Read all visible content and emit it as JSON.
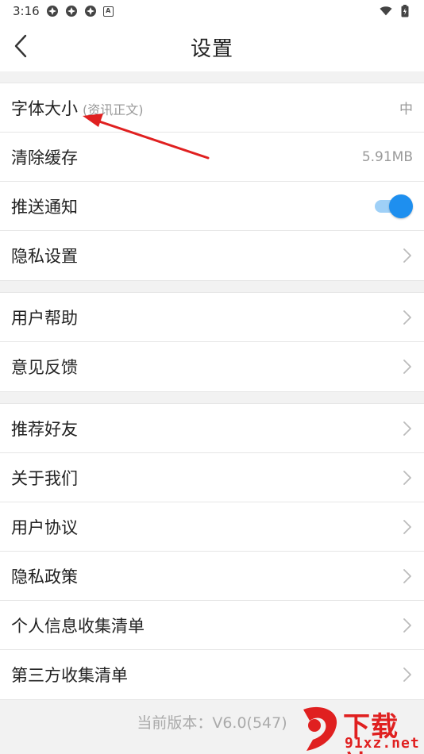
{
  "status_bar": {
    "time": "3:16",
    "notif_badge": "A"
  },
  "header": {
    "title": "设置"
  },
  "groups": [
    {
      "items": [
        {
          "label": "字体大小",
          "sub": "(资讯正文)",
          "value": "中"
        },
        {
          "label": "清除缓存",
          "value": "5.91MB"
        },
        {
          "label": "推送通知",
          "toggle_on": true
        },
        {
          "label": "隐私设置"
        }
      ]
    },
    {
      "items": [
        {
          "label": "用户帮助"
        },
        {
          "label": "意见反馈"
        }
      ]
    },
    {
      "items": [
        {
          "label": "推荐好友"
        },
        {
          "label": "关于我们"
        },
        {
          "label": "用户协议"
        },
        {
          "label": "隐私政策"
        },
        {
          "label": "个人信息收集清单"
        },
        {
          "label": "第三方收集清单"
        }
      ]
    }
  ],
  "footer": {
    "version": "当前版本：V6.0(547)"
  },
  "watermark": {
    "line1": "下载站",
    "line2": "91xz.net"
  },
  "colors": {
    "accent": "#1e8fef",
    "annotation": "#e02020"
  }
}
